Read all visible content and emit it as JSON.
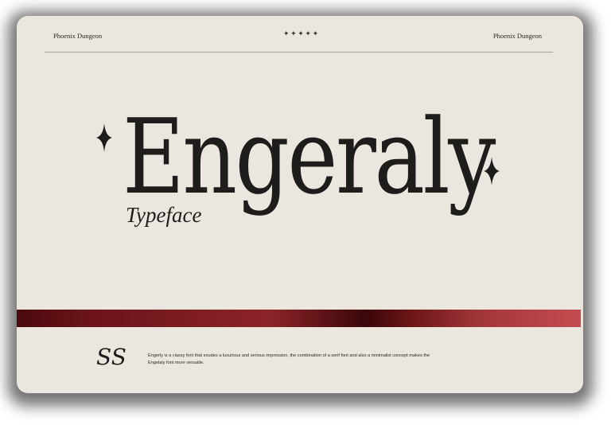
{
  "header": {
    "brand_left": "Phoenix Dungeon",
    "brand_right": "Phoenix Dungeon",
    "stars": "✦✦✦✦✦"
  },
  "hero": {
    "title": "Engeraly",
    "subtitle": "Typeface"
  },
  "footer": {
    "monogram": "SS",
    "description": "Engerly is a classy font that exudes a luxurious and serious impression, the combination of a serif font and also a minimalist concept makes the Engelaly font more versatile."
  },
  "colors": {
    "card_background": "#ebe7df",
    "text": "#1f1d1b",
    "band_red": "#7d1c21"
  },
  "icons": {
    "sparkle": "four-point-star"
  }
}
